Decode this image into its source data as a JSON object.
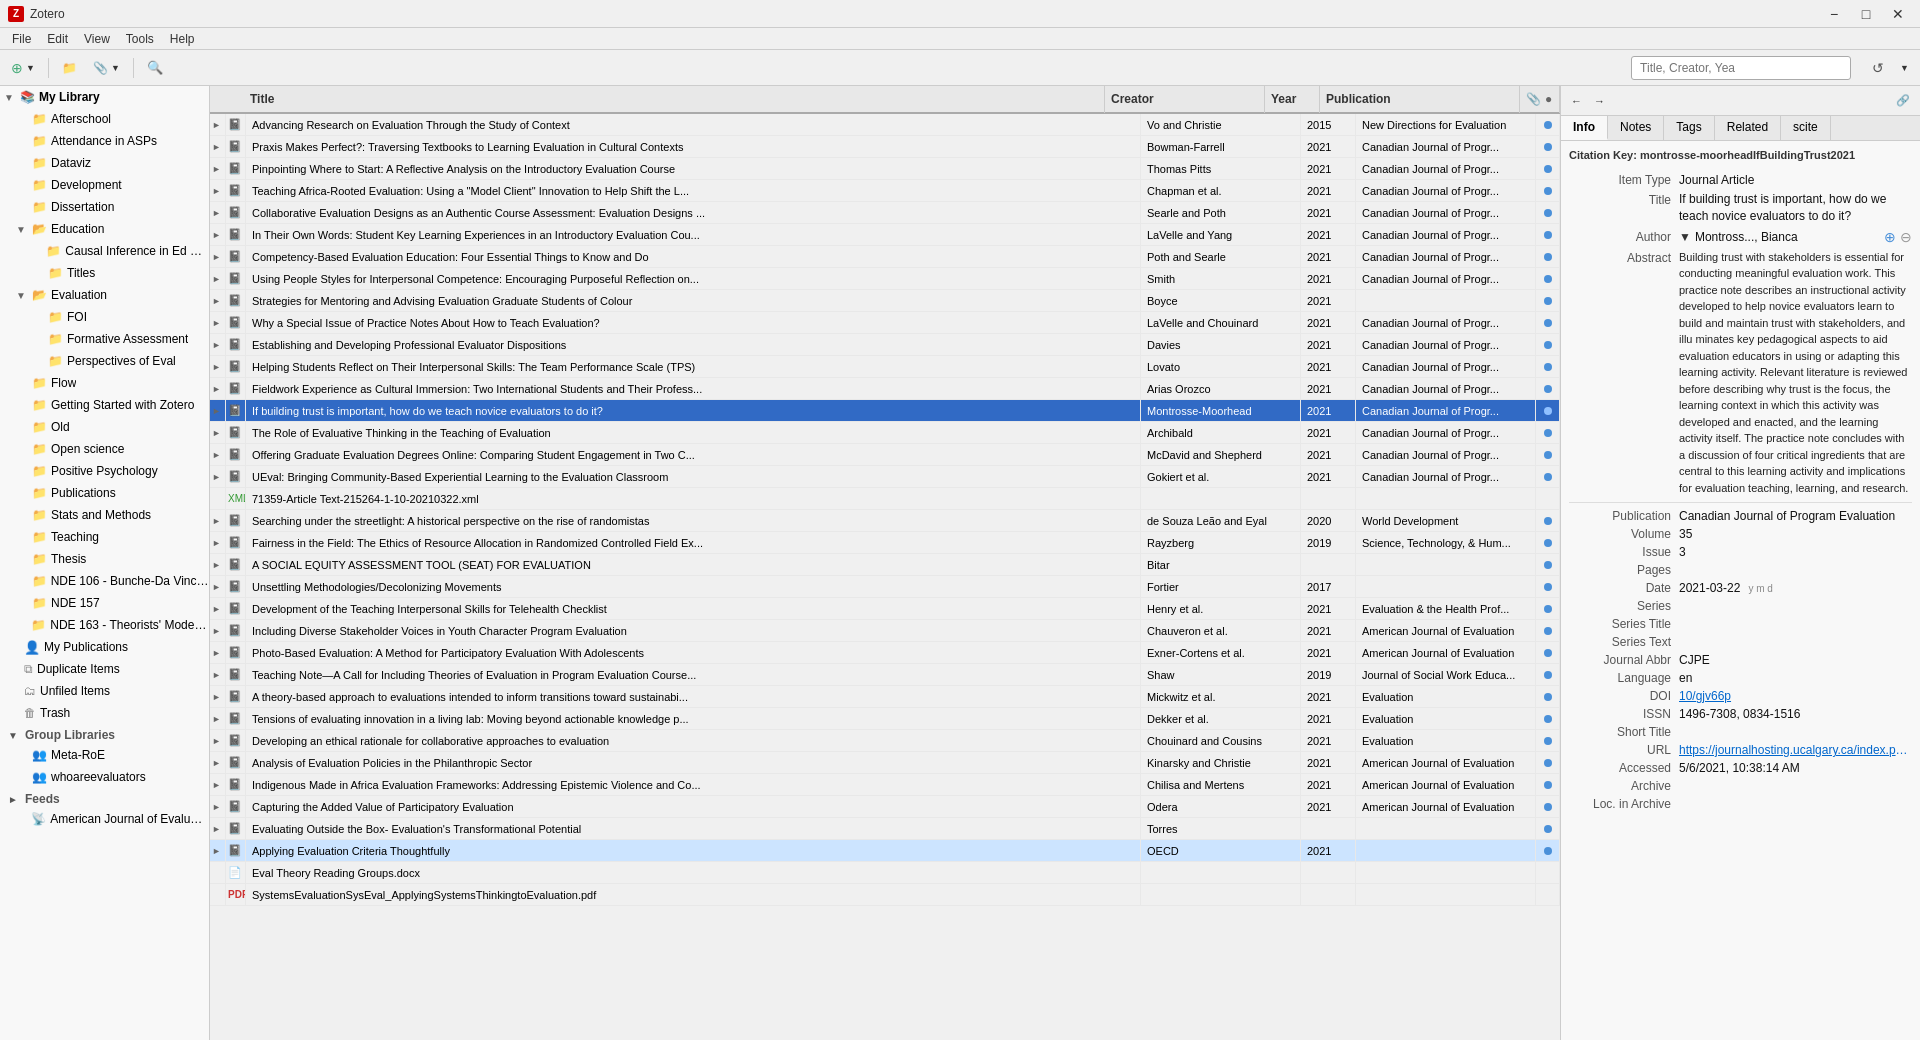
{
  "app": {
    "title": "Zotero",
    "window_controls": [
      "minimize",
      "maximize",
      "close"
    ]
  },
  "menu": {
    "items": [
      "File",
      "Edit",
      "View",
      "Tools",
      "Help"
    ]
  },
  "toolbar": {
    "search_placeholder": "Title, Creator, Yea"
  },
  "left_panel": {
    "my_library": "My Library",
    "folders": [
      {
        "label": "Afterschool",
        "indent": 1,
        "expanded": false
      },
      {
        "label": "Attendance in ASPs",
        "indent": 1,
        "expanded": false
      },
      {
        "label": "Dataviz",
        "indent": 1,
        "expanded": false
      },
      {
        "label": "Development",
        "indent": 1,
        "expanded": false
      },
      {
        "label": "Dissertation",
        "indent": 1,
        "expanded": false
      },
      {
        "label": "Education",
        "indent": 1,
        "expanded": true
      },
      {
        "label": "Causal Inference in Ed Polic...",
        "indent": 2,
        "expanded": false
      },
      {
        "label": "Titles",
        "indent": 2,
        "expanded": false
      },
      {
        "label": "Evaluation",
        "indent": 1,
        "expanded": true
      },
      {
        "label": "FOI",
        "indent": 2,
        "expanded": false
      },
      {
        "label": "Formative Assessment",
        "indent": 2,
        "expanded": false
      },
      {
        "label": "Perspectives of Eval",
        "indent": 2,
        "expanded": false
      },
      {
        "label": "Flow",
        "indent": 1,
        "expanded": false
      },
      {
        "label": "Getting Started with Zotero",
        "indent": 1,
        "expanded": false
      },
      {
        "label": "Old",
        "indent": 1,
        "expanded": false
      },
      {
        "label": "Open science",
        "indent": 1,
        "expanded": false
      },
      {
        "label": "Positive Psychology",
        "indent": 1,
        "expanded": false
      },
      {
        "label": "Publications",
        "indent": 1,
        "expanded": false
      },
      {
        "label": "Stats and Methods",
        "indent": 1,
        "expanded": false
      },
      {
        "label": "Teaching",
        "indent": 1,
        "expanded": false
      },
      {
        "label": "Thesis",
        "indent": 1,
        "expanded": false
      },
      {
        "label": "NDE 106 - Bunche-Da Vinci ...",
        "indent": 1,
        "expanded": false
      },
      {
        "label": "NDE 157",
        "indent": 1,
        "expanded": false
      },
      {
        "label": "NDE 163 - Theorists' Models ...",
        "indent": 1,
        "expanded": false
      },
      {
        "label": "My Publications",
        "indent": 0,
        "expanded": false
      },
      {
        "label": "Duplicate Items",
        "indent": 0,
        "expanded": false
      },
      {
        "label": "Unfiled Items",
        "indent": 0,
        "expanded": false
      },
      {
        "label": "Trash",
        "indent": 0,
        "expanded": false
      }
    ],
    "group_libraries": "Group Libraries",
    "groups": [
      {
        "label": "Meta-RoE",
        "indent": 1
      },
      {
        "label": "whoareevaluators",
        "indent": 1
      }
    ],
    "feeds": "Feeds",
    "feed_items": [
      {
        "label": "American Journal of Evaluation",
        "indent": 1
      }
    ]
  },
  "table": {
    "columns": [
      "Title",
      "Creator",
      "Year",
      "Publication"
    ],
    "rows": [
      {
        "title": "Advancing Research on Evaluation Through the Study of Context",
        "creator": "Vo and Christie",
        "year": "2015",
        "publication": "New Directions for Evaluation",
        "type": "article"
      },
      {
        "title": "Praxis Makes Perfect?: Traversing Textbooks to Learning Evaluation in Cultural Contexts",
        "creator": "Bowman-Farrell",
        "year": "2021",
        "publication": "Canadian Journal of Progr...",
        "type": "article"
      },
      {
        "title": "Pinpointing Where to Start: A Reflective Analysis on the Introductory Evaluation Course",
        "creator": "Thomas Pitts",
        "year": "2021",
        "publication": "Canadian Journal of Progr...",
        "type": "article"
      },
      {
        "title": "Teaching Africa-Rooted Evaluation: Using a \"Model Client\" Innovation to Help Shift the L...",
        "creator": "Chapman et al.",
        "year": "2021",
        "publication": "Canadian Journal of Progr...",
        "type": "article"
      },
      {
        "title": "Collaborative Evaluation Designs as an Authentic Course Assessment: Evaluation Designs ...",
        "creator": "Searle and Poth",
        "year": "2021",
        "publication": "Canadian Journal of Progr...",
        "type": "article"
      },
      {
        "title": "In Their Own Words: Student Key Learning Experiences in an Introductory Evaluation Cou...",
        "creator": "LaVelle and Yang",
        "year": "2021",
        "publication": "Canadian Journal of Progr...",
        "type": "article"
      },
      {
        "title": "Competency-Based Evaluation Education: Four Essential Things to Know and Do",
        "creator": "Poth and Searle",
        "year": "2021",
        "publication": "Canadian Journal of Progr...",
        "type": "article"
      },
      {
        "title": "Using People Styles for Interpersonal Competence: Encouraging Purposeful Reflection on...",
        "creator": "Smith",
        "year": "2021",
        "publication": "Canadian Journal of Progr...",
        "type": "article"
      },
      {
        "title": "Strategies for Mentoring and Advising Evaluation Graduate Students of Colour",
        "creator": "Boyce",
        "year": "2021",
        "publication": "",
        "type": "article"
      },
      {
        "title": "Why a Special Issue of Practice Notes About How to Teach Evaluation?",
        "creator": "LaVelle and Chouinard",
        "year": "2021",
        "publication": "Canadian Journal of Progr...",
        "type": "article"
      },
      {
        "title": "Establishing and Developing Professional Evaluator Dispositions",
        "creator": "Davies",
        "year": "2021",
        "publication": "Canadian Journal of Progr...",
        "type": "article"
      },
      {
        "title": "Helping Students Reflect on Their Interpersonal Skills: The Team Performance Scale (TPS)",
        "creator": "Lovato",
        "year": "2021",
        "publication": "Canadian Journal of Progr...",
        "type": "article"
      },
      {
        "title": "Fieldwork Experience as Cultural Immersion: Two International Students and Their Profess...",
        "creator": "Arias Orozco",
        "year": "2021",
        "publication": "Canadian Journal of Progr...",
        "type": "article"
      },
      {
        "title": "If building trust is important, how do we teach novice evaluators to do it?",
        "creator": "Montrosse-Moorhead",
        "year": "2021",
        "publication": "Canadian Journal of Progr...",
        "type": "article",
        "selected": true
      },
      {
        "title": "The Role of Evaluative Thinking in the Teaching of Evaluation",
        "creator": "Archibald",
        "year": "2021",
        "publication": "Canadian Journal of Progr...",
        "type": "article"
      },
      {
        "title": "Offering Graduate Evaluation Degrees Online: Comparing Student Engagement in Two C...",
        "creator": "McDavid and Shepherd",
        "year": "2021",
        "publication": "Canadian Journal of Progr...",
        "type": "article"
      },
      {
        "title": "UEval: Bringing Community-Based Experiential Learning to the Evaluation Classroom",
        "creator": "Gokiert et al.",
        "year": "2021",
        "publication": "Canadian Journal of Progr...",
        "type": "article"
      },
      {
        "title": "71359-Article Text-215264-1-10-20210322.xml",
        "creator": "",
        "year": "",
        "publication": "",
        "type": "xml"
      },
      {
        "title": "Searching under the streetlight: A historical perspective on the rise of randomistas",
        "creator": "de Souza Leão and Eyal",
        "year": "2020",
        "publication": "World Development",
        "type": "article"
      },
      {
        "title": "Fairness in the Field: The Ethics of Resource Allocation in Randomized Controlled Field Ex...",
        "creator": "Rayzberg",
        "year": "2019",
        "publication": "Science, Technology, & Hum...",
        "type": "article"
      },
      {
        "title": "A SOCIAL EQUITY ASSESSMENT TOOL (SEAT) FOR EVALUATION",
        "creator": "Bitar",
        "year": "",
        "publication": "",
        "type": "article"
      },
      {
        "title": "Unsettling Methodologies/Decolonizing Movements",
        "creator": "Fortier",
        "year": "2017",
        "publication": "",
        "type": "article"
      },
      {
        "title": "Development of the Teaching Interpersonal Skills for Telehealth Checklist",
        "creator": "Henry et al.",
        "year": "2021",
        "publication": "Evaluation & the Health Prof...",
        "type": "article"
      },
      {
        "title": "Including Diverse Stakeholder Voices in Youth Character Program Evaluation",
        "creator": "Chauveron et al.",
        "year": "2021",
        "publication": "American Journal of Evaluation",
        "type": "article"
      },
      {
        "title": "Photo-Based Evaluation: A Method for Participatory Evaluation With Adolescents",
        "creator": "Exner-Cortens et al.",
        "year": "2021",
        "publication": "American Journal of Evaluation",
        "type": "article"
      },
      {
        "title": "Teaching Note—A Call for Including Theories of Evaluation in Program Evaluation Course...",
        "creator": "Shaw",
        "year": "2019",
        "publication": "Journal of Social Work Educa...",
        "type": "article"
      },
      {
        "title": "A theory-based approach to evaluations intended to inform transitions toward sustainabi...",
        "creator": "Mickwitz et al.",
        "year": "2021",
        "publication": "Evaluation",
        "type": "article"
      },
      {
        "title": "Tensions of evaluating innovation in a living lab: Moving beyond actionable knowledge p...",
        "creator": "Dekker et al.",
        "year": "2021",
        "publication": "Evaluation",
        "type": "article"
      },
      {
        "title": "Developing an ethical rationale for collaborative approaches to evaluation",
        "creator": "Chouinard and Cousins",
        "year": "2021",
        "publication": "Evaluation",
        "type": "article"
      },
      {
        "title": "Analysis of Evaluation Policies in the Philanthropic Sector",
        "creator": "Kinarsky and Christie",
        "year": "2021",
        "publication": "American Journal of Evaluation",
        "type": "article"
      },
      {
        "title": "Indigenous Made in Africa Evaluation Frameworks: Addressing Epistemic Violence and Co...",
        "creator": "Chilisa and Mertens",
        "year": "2021",
        "publication": "American Journal of Evaluation",
        "type": "article"
      },
      {
        "title": "Capturing the Added Value of Participatory Evaluation",
        "creator": "Odera",
        "year": "2021",
        "publication": "American Journal of Evaluation",
        "type": "article"
      },
      {
        "title": "Evaluating Outside the Box- Evaluation's Transformational Potential",
        "creator": "Torres",
        "year": "",
        "publication": "",
        "type": "article"
      },
      {
        "title": "Applying Evaluation Criteria Thoughtfully",
        "creator": "OECD",
        "year": "2021",
        "publication": "",
        "type": "article",
        "highlighted": true
      },
      {
        "title": "Eval Theory Reading Groups.docx",
        "creator": "",
        "year": "",
        "publication": "",
        "type": "doc"
      },
      {
        "title": "SystemsEvaluationSysEval_ApplyingSystemsThinkingtoEvaluation.pdf",
        "creator": "",
        "year": "",
        "publication": "",
        "type": "pdf"
      }
    ]
  },
  "right_panel": {
    "toolbar_buttons": [
      "←",
      "→"
    ],
    "tabs": [
      "Info",
      "Notes",
      "Tags",
      "Related",
      "scite"
    ],
    "active_tab": "Info",
    "citation_key": "Citation Key: montrosse-moorheadIfBuildingTrust2021",
    "fields": {
      "item_type_label": "Item Type",
      "item_type_value": "Journal Article",
      "title_label": "Title",
      "title_value": "If building trust is important, how do we teach novice evaluators to do it?",
      "author_label": "Author",
      "author_value": "Montross..., Bianca",
      "abstract_label": "Abstract",
      "abstract_value": "Building trust with stakeholders is essential for conducting meaningful evaluation work. This practice note describes an instructional activity developed to help novice evaluators learn to build and maintain trust with stakeholders, and illu minates key pedagogical aspects to aid evaluation educators in using or adapting this learning activity. Relevant literature is reviewed before describing why trust is the focus, the learning context in which this activity was developed and enacted, and the learning activity itself. The practice note concludes with a discussion of four critical ingredients that are central to this learning activity and implications for evaluation teaching, learning, and research.",
      "publication_label": "Publication",
      "publication_value": "Canadian Journal of Program Evaluation",
      "volume_label": "Volume",
      "volume_value": "35",
      "issue_label": "Issue",
      "issue_value": "3",
      "pages_label": "Pages",
      "pages_value": "",
      "date_label": "Date",
      "date_value": "2021-03-22",
      "series_label": "Series",
      "series_value": "",
      "series_title_label": "Series Title",
      "series_title_value": "",
      "series_text_label": "Series Text",
      "series_text_value": "",
      "journal_abbr_label": "Journal Abbr",
      "journal_abbr_value": "CJPE",
      "language_label": "Language",
      "language_value": "en",
      "doi_label": "DOI",
      "doi_value": "10/gjv66p",
      "issn_label": "ISSN",
      "issn_value": "1496-7308, 0834-1516",
      "short_title_label": "Short Title",
      "short_title_value": "",
      "url_label": "URL",
      "url_value": "https://journalhosting.ucalgary.ca/index.ph...",
      "accessed_label": "Accessed",
      "accessed_value": "5/6/2021, 10:38:14 AM",
      "archive_label": "Archive",
      "archive_value": "",
      "loc_in_archive_label": "Loc. in Archive",
      "loc_in_archive_value": ""
    }
  }
}
